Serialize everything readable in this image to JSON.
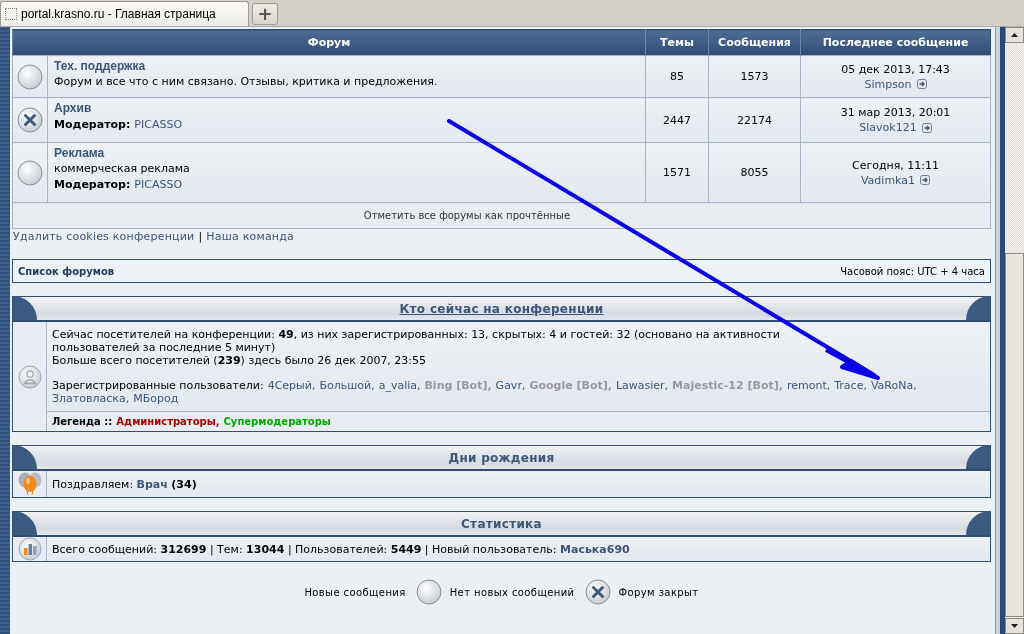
{
  "browser_tab": {
    "title": "portal.krasno.ru - Главная страница",
    "new_tab": "+"
  },
  "forum_table": {
    "columns": [
      "Форум",
      "Темы",
      "Сообщения",
      "Последнее сообщение"
    ],
    "rows": [
      {
        "locked": false,
        "title": "Тех. поддержка",
        "description": "Форум и все что с ним связано. Отзывы, критика и предложения.",
        "topics": "85",
        "posts": "1573",
        "last_date": "05 дек 2013, 17:43",
        "last_author": "Simpson"
      },
      {
        "locked": true,
        "title": "Архив",
        "moderator_label": "Модератор:",
        "moderator": "PICASSO",
        "topics": "2447",
        "posts": "22174",
        "last_date": "31 мар 2013, 20:01",
        "last_author": "Slavok121"
      },
      {
        "locked": false,
        "title": "Реклама",
        "description": "коммерческая реклама",
        "moderator_label": "Модератор:",
        "moderator": "PICASSO",
        "topics": "1571",
        "posts": "8055",
        "last_date": "Сегодня, 11:11",
        "last_author": "Vadimka1"
      }
    ],
    "mark_read": "Отметить все форумы как прочтённые"
  },
  "links": {
    "items": [
      "Удалить cookies конференции",
      "Наша команда"
    ],
    "separator": "|"
  },
  "nav": {
    "breadcrumb": "Список форумов",
    "timezone": "Часовой пояс: UTC + 4 часа"
  },
  "online": {
    "title": "Кто сейчас на конференции",
    "summary": "Сейчас посетителей на конференции: **49**, из них зарегистрированных: 13, скрытых: 4 и гостей: 32 (основано на активности пользователей за последние 5 минут)",
    "record": "Больше всего посетителей (**239**) здесь было 26 дек 2007, 23:55",
    "users_label": "Зарегистрированные пользователи:",
    "users": [
      {
        "name": "4Серый,",
        "kind": "user"
      },
      {
        "name": "Большой,",
        "kind": "user"
      },
      {
        "name": "a_valia,",
        "kind": "user"
      },
      {
        "name": "Bing [Bot],",
        "kind": "bot"
      },
      {
        "name": "Gavr,",
        "kind": "user"
      },
      {
        "name": "Google [Bot],",
        "kind": "bot"
      },
      {
        "name": "Lawasier,",
        "kind": "user"
      },
      {
        "name": "Majestic-12 [Bot],",
        "kind": "bot"
      },
      {
        "name": "remont,",
        "kind": "user"
      },
      {
        "name": "Trace,",
        "kind": "user"
      },
      {
        "name": "VaRoNa,",
        "kind": "user"
      },
      {
        "name": "Златовласка,",
        "kind": "user"
      },
      {
        "name": "МБород",
        "kind": "user"
      }
    ],
    "legend_label": "Легенда ::",
    "legend": [
      {
        "name": "Администраторы,",
        "color": "#aa0000"
      },
      {
        "name": "Супермодераторы",
        "color": "#00aa00"
      }
    ]
  },
  "birthdays": {
    "title": "Дни рождения",
    "label": "Поздравляем:",
    "user": "Врач",
    "age": "(34)"
  },
  "stats": {
    "title": "Статистика",
    "text": "Всего сообщений: **312699** | Тем: **13044** | Пользователей: **5449** | Новый пользователь:",
    "newest_user": "Маська690"
  },
  "icon_legend": [
    {
      "kind": "new",
      "label": "Новые сообщения"
    },
    {
      "kind": "no_new",
      "label": "Нет новых сообщений"
    },
    {
      "kind": "locked",
      "label": "Форум закрыт"
    }
  ]
}
